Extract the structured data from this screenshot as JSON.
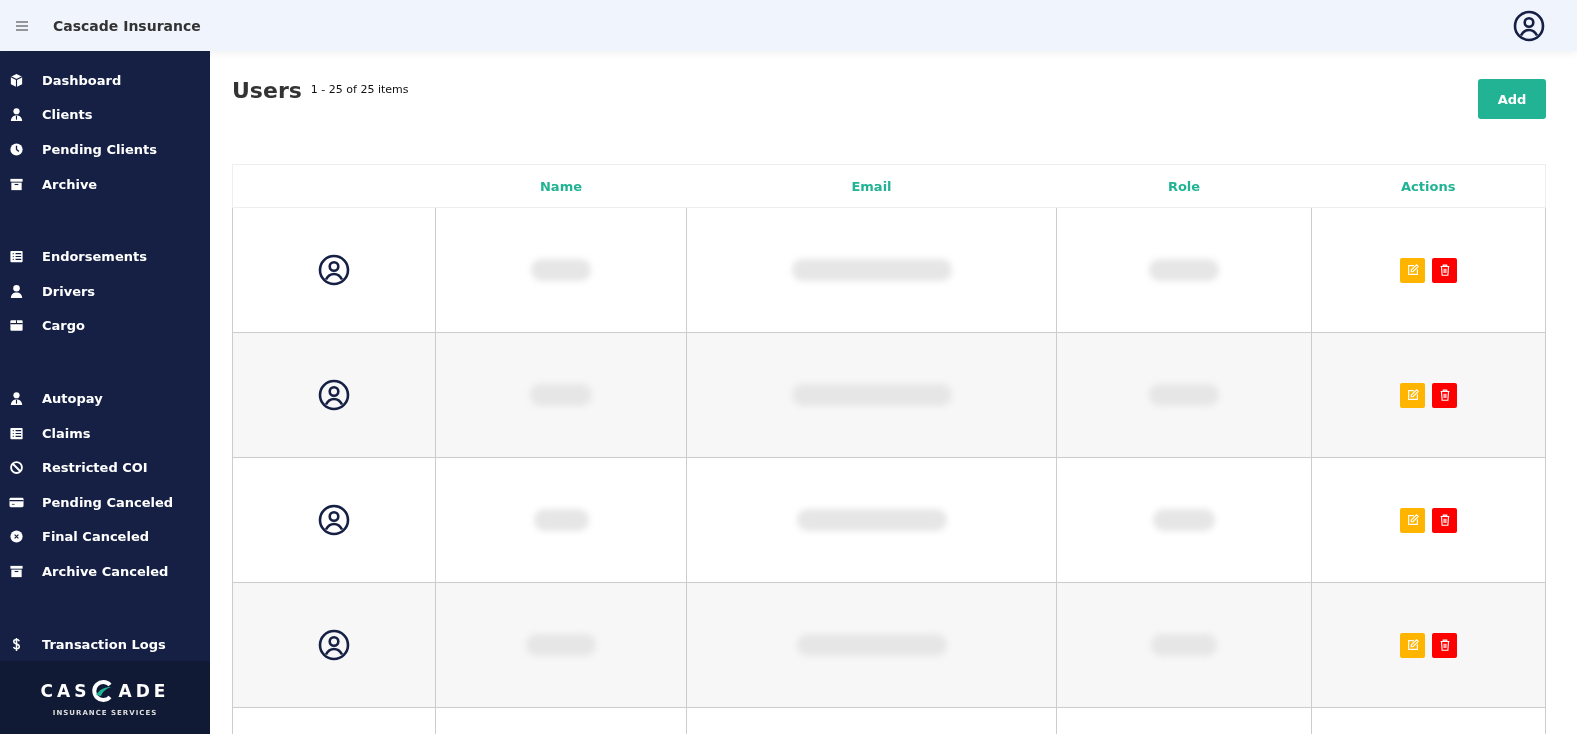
{
  "header": {
    "title": "Cascade Insurance"
  },
  "sidebar": {
    "groups": [
      [
        {
          "label": "Dashboard",
          "kind": "cube"
        },
        {
          "label": "Clients",
          "kind": "user-tie"
        },
        {
          "label": "Pending Clients",
          "kind": "clock"
        },
        {
          "label": "Archive",
          "kind": "archive"
        }
      ],
      [
        {
          "label": "Endorsements",
          "kind": "list"
        },
        {
          "label": "Drivers",
          "kind": "user"
        },
        {
          "label": "Cargo",
          "kind": "box"
        }
      ],
      [
        {
          "label": "Autopay",
          "kind": "user-tie"
        },
        {
          "label": "Claims",
          "kind": "list"
        },
        {
          "label": "Restricted COI",
          "kind": "ban"
        },
        {
          "label": "Pending Canceled",
          "kind": "card"
        },
        {
          "label": "Final Canceled",
          "kind": "x-circle"
        },
        {
          "label": "Archive Canceled",
          "kind": "archive"
        }
      ],
      [
        {
          "label": "Transaction Logs",
          "kind": "dollar"
        }
      ]
    ],
    "logo": {
      "left": "CAS",
      "right": "ADE",
      "tagline": "INSURANCE SERVICES"
    }
  },
  "page": {
    "title": "Users",
    "count": "1 - 25 of 25 items",
    "add_button": "Add"
  },
  "table": {
    "columns": [
      "Name",
      "Email",
      "Role",
      "Actions"
    ],
    "rows": [
      {
        "kind": "user"
      },
      {
        "kind": "user"
      },
      {
        "kind": "user"
      },
      {
        "kind": "user"
      },
      {
        "kind": "empty"
      }
    ]
  }
}
